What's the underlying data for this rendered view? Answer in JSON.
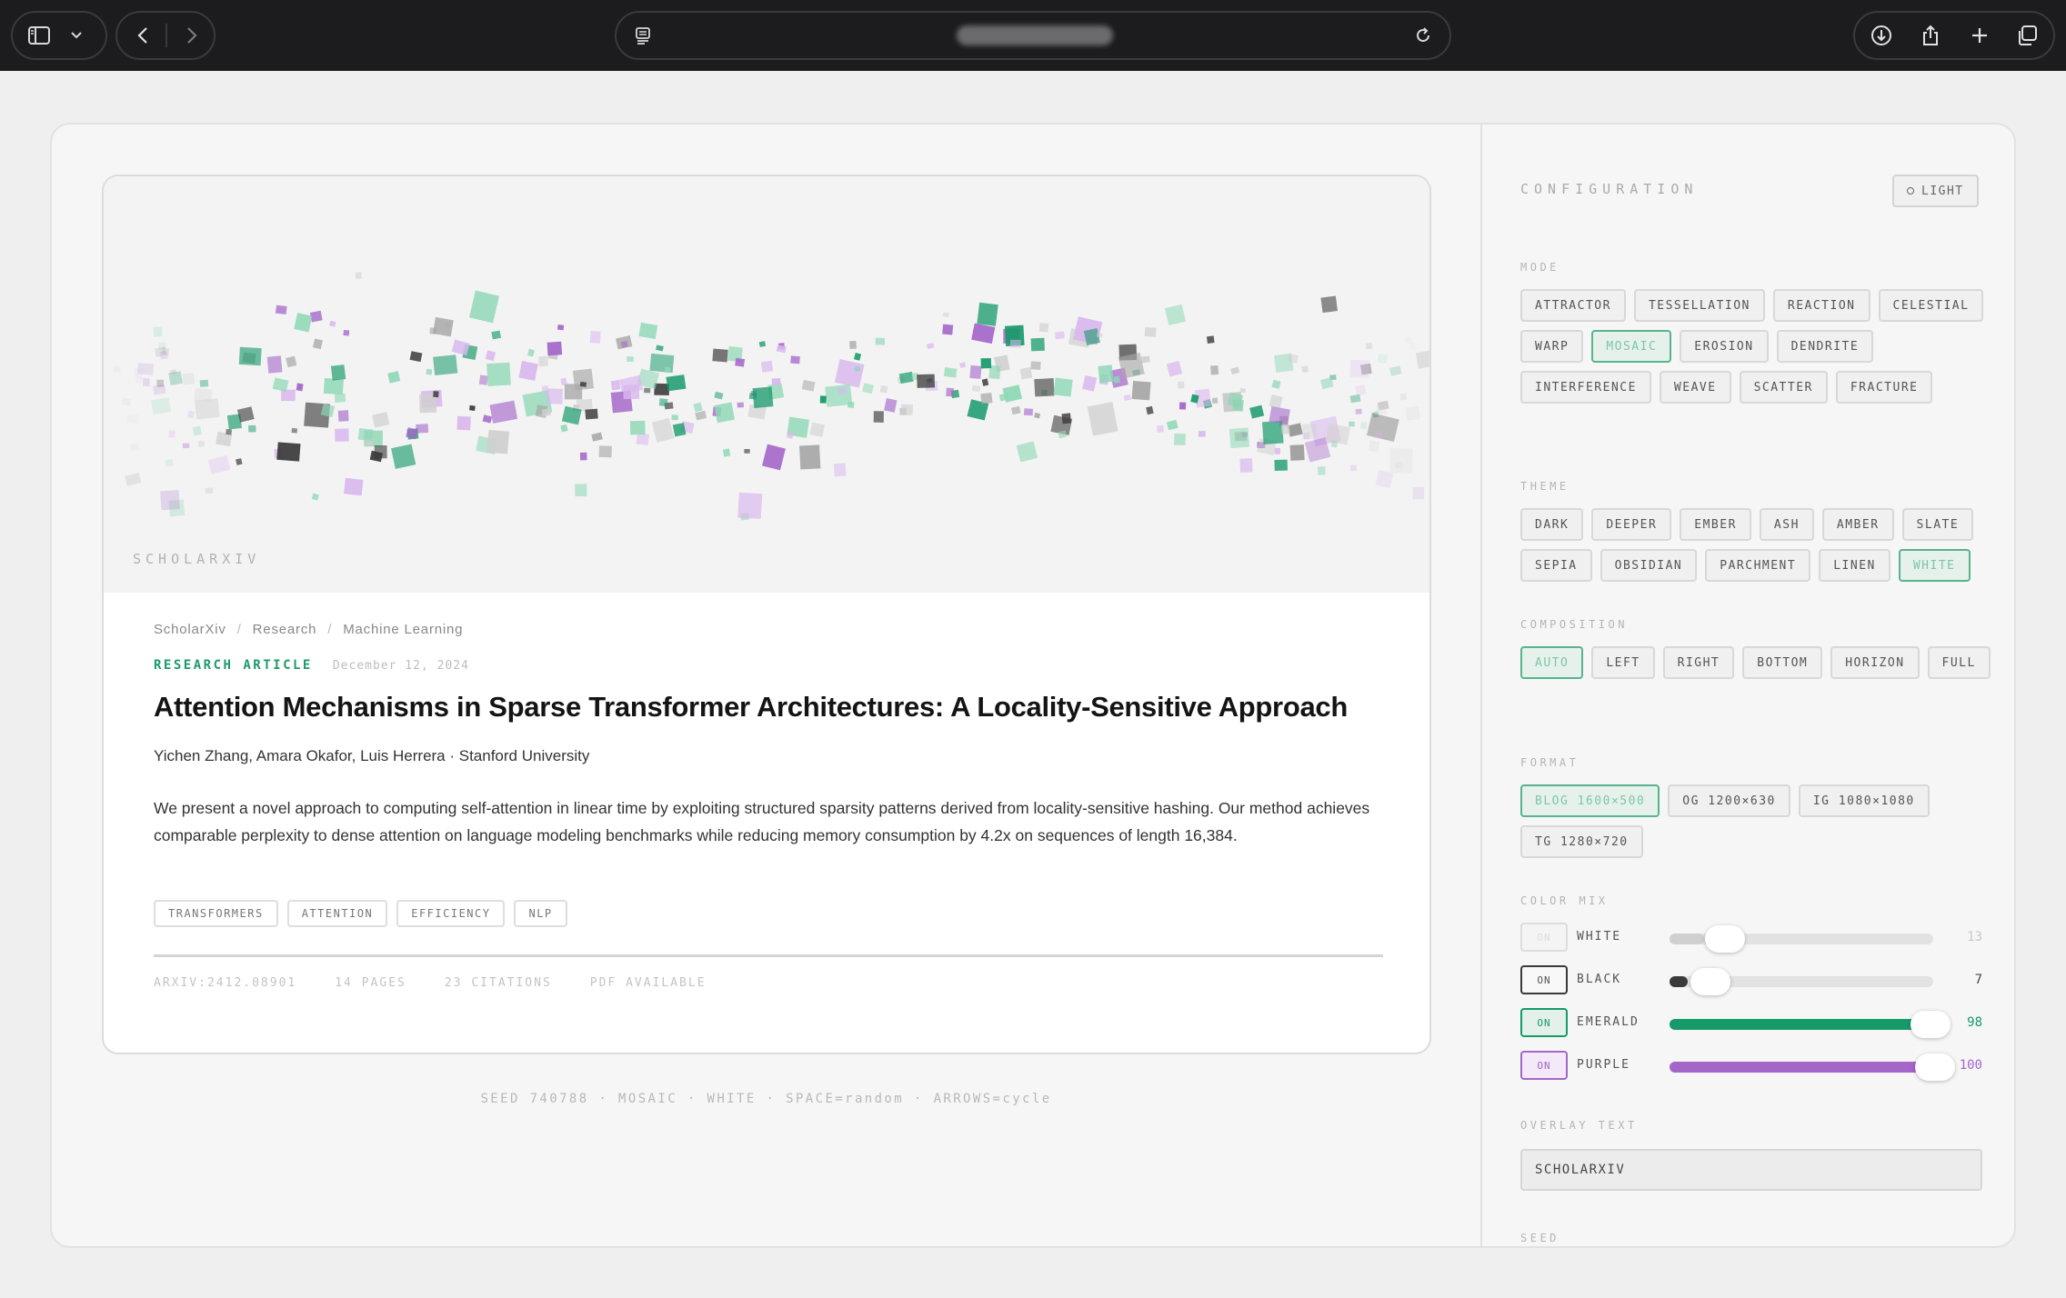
{
  "browser": {
    "url_text": "",
    "icons": [
      "sidebar-icon",
      "chevron-down-icon",
      "back-icon",
      "forward-icon",
      "reader-icon",
      "reload-icon",
      "download-icon",
      "share-icon",
      "new-tab-icon",
      "tabs-icon"
    ]
  },
  "card": {
    "overlay_text": "SCHOLARXIV",
    "breadcrumb": [
      "ScholarXiv",
      "Research",
      "Machine Learning"
    ],
    "kind": "RESEARCH ARTICLE",
    "date": "December 12, 2024",
    "title": "Attention Mechanisms in Sparse Transformer Architectures: A Locality-Sensitive Approach",
    "authors": "Yichen Zhang, Amara Okafor, Luis Herrera · Stanford University",
    "abstract": "We present a novel approach to computing self-attention in linear time by exploiting structured sparsity patterns derived from locality-sensitive hashing. Our method achieves comparable perplexity to dense attention on language modeling benchmarks while reducing memory consumption by 4.2x on sequences of length 16,384.",
    "tags": [
      "TRANSFORMERS",
      "ATTENTION",
      "EFFICIENCY",
      "NLP"
    ],
    "stats": [
      "ARXIV:2412.08901",
      "14 PAGES",
      "23 CITATIONS",
      "PDF AVAILABLE"
    ]
  },
  "footer": "SEED 740788 · MOSAIC · WHITE · SPACE=random · ARROWS=cycle",
  "config": {
    "title": "CONFIGURATION",
    "light_button": "LIGHT",
    "mode": {
      "label": "MODE",
      "options": [
        "ATTRACTOR",
        "TESSELLATION",
        "REACTION",
        "CELESTIAL",
        "WARP",
        "MOSAIC",
        "EROSION",
        "DENDRITE",
        "INTERFERENCE",
        "WEAVE",
        "SCATTER",
        "FRACTURE"
      ],
      "selected": "MOSAIC"
    },
    "theme": {
      "label": "THEME",
      "options": [
        "DARK",
        "DEEPER",
        "EMBER",
        "ASH",
        "AMBER",
        "SLATE",
        "SEPIA",
        "OBSIDIAN",
        "PARCHMENT",
        "LINEN",
        "WHITE"
      ],
      "selected": "WHITE"
    },
    "composition": {
      "label": "COMPOSITION",
      "options": [
        "AUTO",
        "LEFT",
        "RIGHT",
        "BOTTOM",
        "HORIZON",
        "FULL"
      ],
      "selected": "AUTO"
    },
    "format": {
      "label": "FORMAT",
      "options": [
        "BLOG 1600×500",
        "OG 1200×630",
        "IG 1080×1080",
        "TG 1280×720"
      ],
      "selected": "BLOG 1600×500"
    },
    "color_mix": {
      "label": "COLOR MIX",
      "rows": [
        {
          "toggle": "ON",
          "name": "WHITE",
          "value": "13",
          "level": 13,
          "color": "#d0d0d0",
          "value_color": "#c8c8c8",
          "toggle_on": false
        },
        {
          "toggle": "ON",
          "name": "BLACK",
          "value": "7",
          "level": 7,
          "color": "#3a3a3a",
          "value_color": "#444444",
          "toggle_on": true
        },
        {
          "toggle": "ON",
          "name": "EMERALD",
          "value": "98",
          "level": 98,
          "color": "#169a6a",
          "value_color": "#169a6a",
          "toggle_on": true
        },
        {
          "toggle": "ON",
          "name": "PURPLE",
          "value": "100",
          "level": 100,
          "color": "#a466c9",
          "value_color": "#a466c9",
          "toggle_on": true
        }
      ]
    },
    "overlay_text": {
      "label": "OVERLAY TEXT",
      "value": "SCHOLARXIV"
    },
    "seed": {
      "label": "SEED"
    }
  },
  "palette": {
    "emerald": "#169a6a",
    "emerald_light": "#8fd8b6",
    "purple": "#a466c9",
    "purple_light": "#d9b8ee",
    "dark": "#3a3a3a",
    "grey": "#a8a8a8"
  }
}
